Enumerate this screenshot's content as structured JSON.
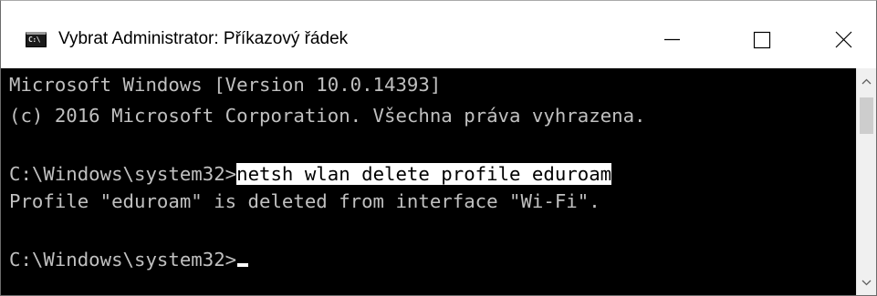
{
  "window": {
    "title": "Vybrat Administrator: Příkazový řádek",
    "icon_label": "C:\\",
    "controls": {
      "minimize": "minimize-icon",
      "maximize": "maximize-icon",
      "close": "close-icon"
    }
  },
  "console": {
    "lines": [
      "Microsoft Windows [Version 10.0.14393]",
      "(c) 2016 Microsoft Corporation. Všechna práva vyhrazena.",
      "",
      "Profile \"eduroam\" is deleted from interface \"Wi-Fi\".",
      ""
    ],
    "prompt1": "C:\\Windows\\system32>",
    "command_selected": "netsh wlan delete profile eduroam",
    "prompt2": "C:\\Windows\\system32>"
  },
  "colors": {
    "console_bg": "#000000",
    "console_fg": "#c0c0c0",
    "selection_bg": "#ffffff",
    "selection_fg": "#000000"
  }
}
